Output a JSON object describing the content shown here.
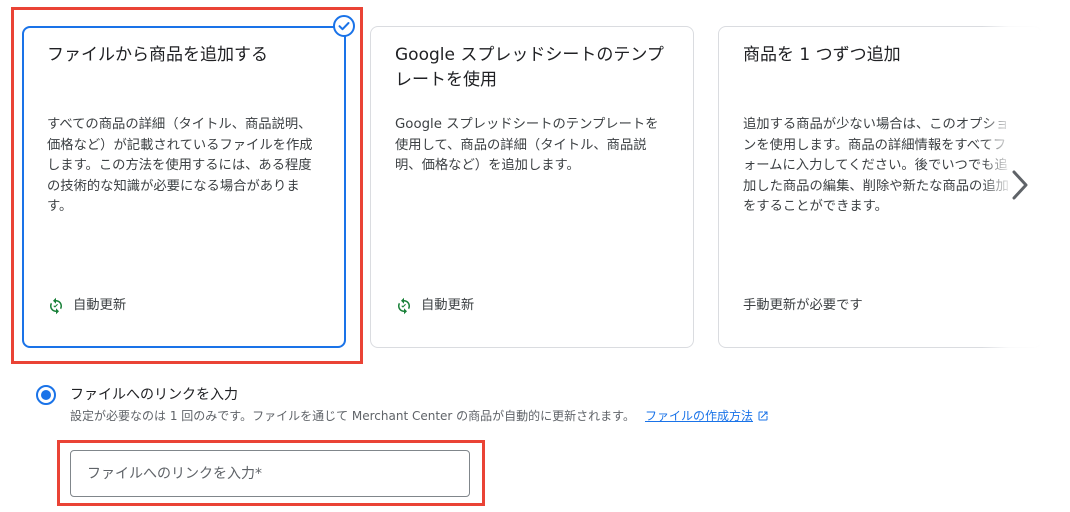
{
  "cards": [
    {
      "title": "ファイルから商品を追加する",
      "description": "すべての商品の詳細（タイトル、商品説明、価格など）が記載されているファイルを作成します。この方法を使用するには、ある程度の技術的な知識が必要になる場合があります。",
      "footer": "自動更新",
      "footer_icon": "sync-icon",
      "selected": true
    },
    {
      "title": "Google スプレッドシートのテンプレートを使用",
      "description": "Google スプレッドシートのテンプレートを使用して、商品の詳細（タイトル、商品説明、価格など）を追加します。",
      "footer": "自動更新",
      "footer_icon": "sync-icon",
      "selected": false
    },
    {
      "title": "商品を 1 つずつ追加",
      "description": "追加する商品が少ない場合は、このオプションを使用します。商品の詳細情報をすべてフォームに入力してください。後でいつでも追加した商品の編集、削除や新たな商品の追加をすることができます。",
      "footer": "手動更新が必要です",
      "footer_icon": "",
      "selected": false
    }
  ],
  "carousel": {
    "next_icon": "chevron-right-icon"
  },
  "link_option": {
    "label": "ファイルへのリンクを入力",
    "selected": true,
    "helper": "設定が必要なのは 1 回のみです。ファイルを通じて Merchant Center の商品が自動的に更新されます。",
    "help_link": "ファイルの作成方法",
    "help_link_icon": "open-in-new-icon",
    "input_placeholder": "ファイルへのリンクを入力*",
    "input_value": ""
  },
  "colors": {
    "accent": "#1a73e8",
    "success": "#188038",
    "highlight": "#ea4335",
    "border": "#dadce0"
  }
}
